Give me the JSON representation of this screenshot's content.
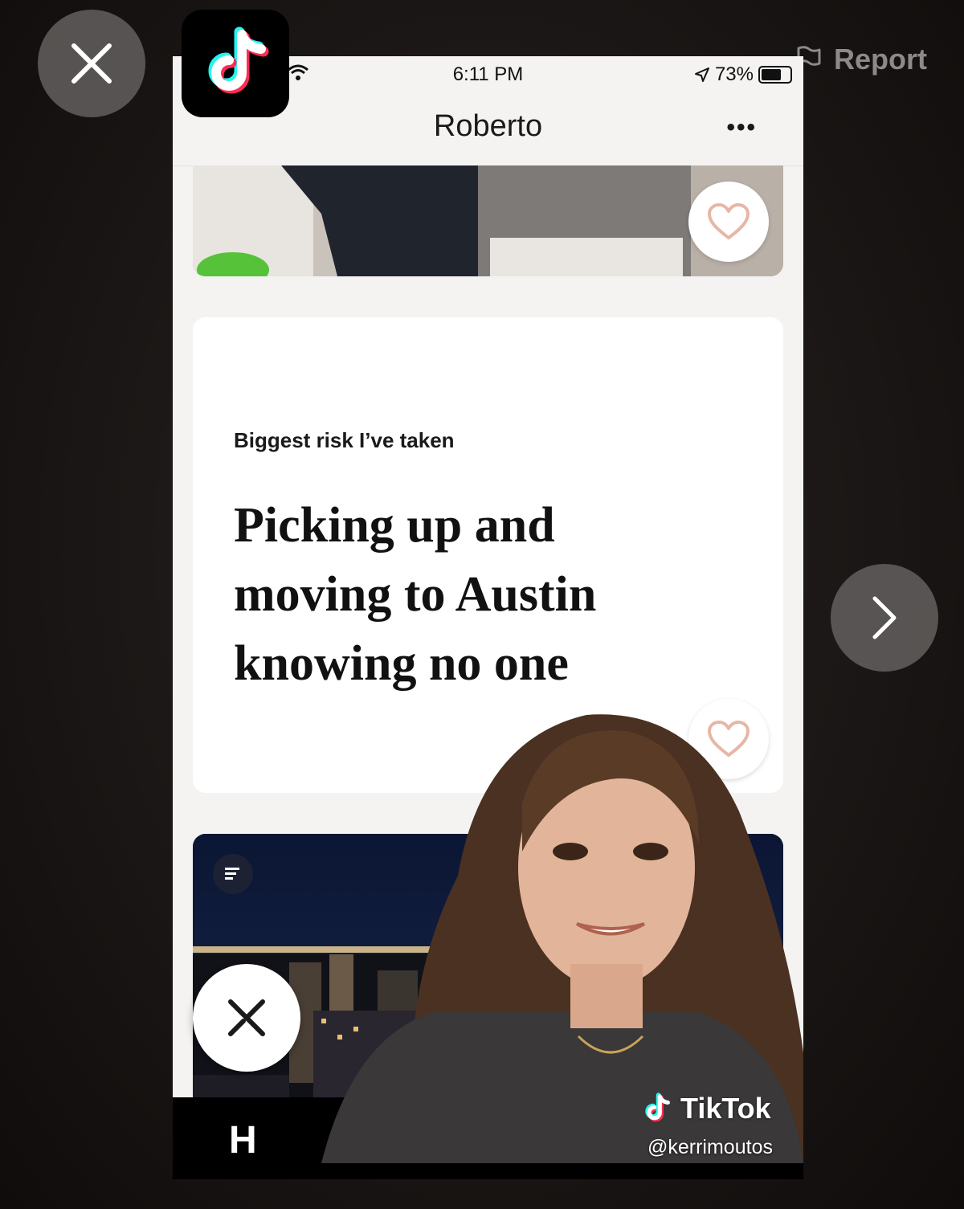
{
  "overlay": {
    "report_label": "Report",
    "watermark_brand": "TikTok",
    "watermark_handle": "@kerrimoutos"
  },
  "status_bar": {
    "time": "6:11 PM",
    "battery": "73%"
  },
  "profile": {
    "name": "Roberto",
    "more_label": "•••"
  },
  "prompt": {
    "question": "Biggest risk I’ve taken",
    "answer": "Picking up and moving to Austin knowing no one"
  },
  "bottom_bar": {
    "logo": "H"
  },
  "icons": [
    "close-icon",
    "chevron-right-icon",
    "flag-icon",
    "tiktok-logo-icon",
    "wifi-icon",
    "location-arrow-icon",
    "battery-icon",
    "heart-icon",
    "list-icon",
    "skip-x-icon"
  ],
  "colors": {
    "heart_accent": "#e7b6a6",
    "phone_background": "#f4f3f2",
    "card_background": "#ffffff",
    "night_sky": "#0d1730",
    "tiktok_cyan": "#25f4ee",
    "tiktok_red": "#fe2c55"
  }
}
